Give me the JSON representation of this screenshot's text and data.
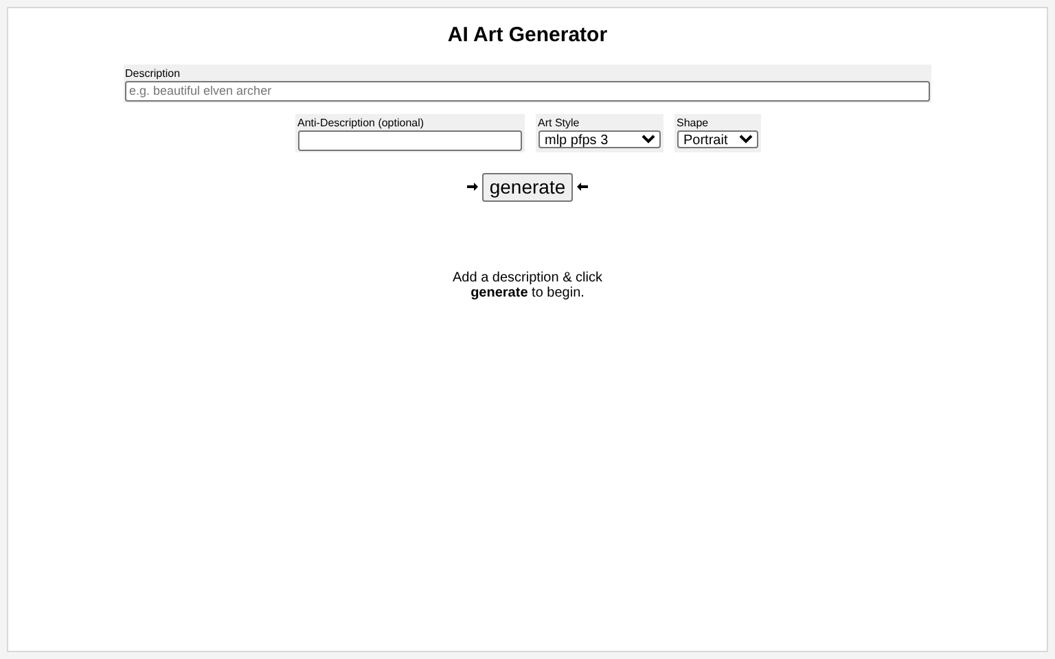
{
  "title": "AI Art Generator",
  "description": {
    "label": "Description",
    "placeholder": "e.g. beautiful elven archer"
  },
  "anti_description": {
    "label": "Anti-Description (optional)"
  },
  "art_style": {
    "label": "Art Style",
    "value": "mlp pfps 3"
  },
  "shape": {
    "label": "Shape",
    "value": "Portrait"
  },
  "generate_button": "generate",
  "hint": "Add a description & click **generate** to begin."
}
